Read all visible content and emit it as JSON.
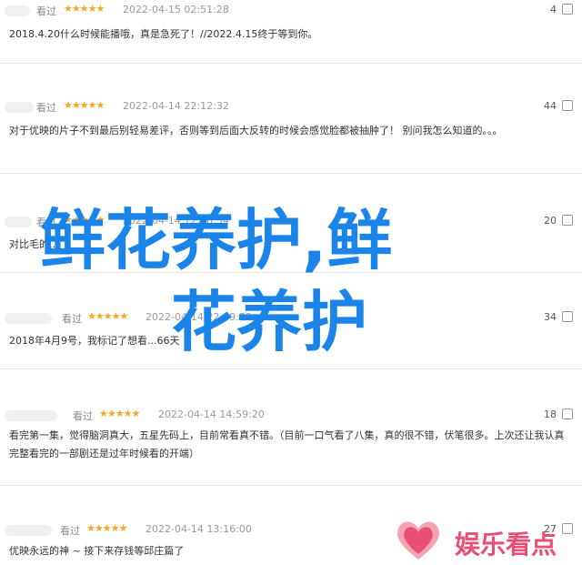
{
  "comments": [
    {
      "user": "看过",
      "stars": "★★★★★",
      "time": "2022-04-15 02:51:28",
      "votes": "4",
      "text": "2018.4.20什么时候能播哦，真是急死了！//2022.4.15终于等到你。"
    },
    {
      "user": "看过",
      "stars": "★★★★★",
      "time": "2022-04-14 22:12:32",
      "votes": "44",
      "text": "对于优映的片子不到最后别轻易差评，否则等到后面大反转的时候会感觉脸都被抽肿了！ 别问我怎么知道的。。。"
    },
    {
      "user": "看过",
      "stars": "★★★★★",
      "time": "2022-04-14 12:08:54",
      "votes": "20",
      "text": "对比毛的..."
    },
    {
      "user": "看过",
      "stars": "★★★★★",
      "time": "2022-04-14 22:49:33",
      "votes": "34",
      "text": "2018年4月9号，我标记了想看...66天"
    },
    {
      "user": "看过",
      "stars": "★★★★★",
      "time": "2022-04-14 14:59:20",
      "votes": "18",
      "text": "看完第一集，觉得脑洞真大，五星先码上，目前常看真不错。（目前一口气看了八集，真的很不错，伏笔很多。上次还让我认真完整看完的一部剧还是过年时候看的开端）"
    },
    {
      "user": "看过",
      "stars": "★★★★★",
      "time": "2022-04-14 13:16:00",
      "votes": "27",
      "text": "优映永远的神 ~ 接下来存钱等邱庄篇了"
    }
  ],
  "overlay": {
    "line1": "鲜花养护,鲜",
    "line2": "花养护",
    "color": "#1a84e8"
  },
  "logo": {
    "text": "娱乐看点",
    "icon": "heart-icon",
    "color": "#e84f72"
  }
}
